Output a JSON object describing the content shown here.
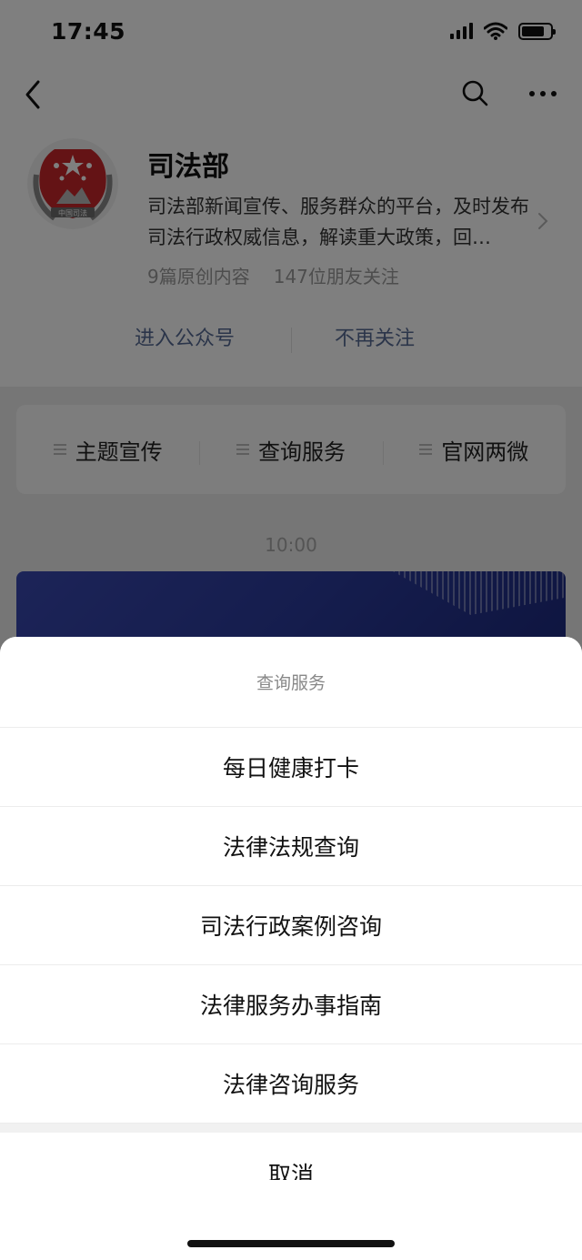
{
  "status_bar": {
    "time": "17:45"
  },
  "account": {
    "name": "司法部",
    "description": "司法部新闻宣传、服务群众的平台，及时发布司法行政权威信息，解读重大政策，回…",
    "original_count": "9篇原创内容",
    "friends_following": "147位朋友关注",
    "enter_label": "进入公众号",
    "unfollow_label": "不再关注",
    "emblem_text": "中国司法"
  },
  "menu": [
    {
      "label": "主题宣传"
    },
    {
      "label": "查询服务"
    },
    {
      "label": "官网两微"
    }
  ],
  "feed": {
    "timestamp": "10:00"
  },
  "action_sheet": {
    "title": "查询服务",
    "options": [
      {
        "label": "每日健康打卡"
      },
      {
        "label": "法律法规查询"
      },
      {
        "label": "司法行政案例咨询"
      },
      {
        "label": "法律服务办事指南"
      },
      {
        "label": "法律咨询服务"
      }
    ],
    "cancel_label": "取消"
  },
  "colors": {
    "link": "#576b95",
    "overlay": "rgba(0,0,0,0.5)",
    "emblem_red": "#c8272b"
  },
  "icons": [
    "back-icon",
    "search-icon",
    "more-icon",
    "chevron-right-icon",
    "menu-lines-icon",
    "signal-icon",
    "wifi-icon",
    "battery-icon"
  ]
}
